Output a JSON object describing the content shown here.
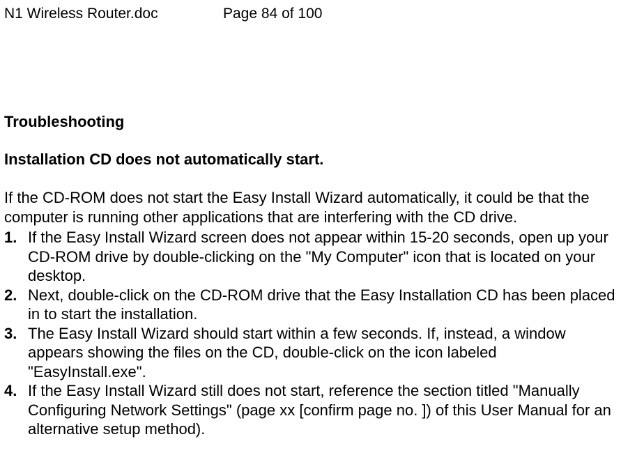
{
  "header": {
    "filename": "N1 Wireless Router.doc",
    "page_indicator": "Page 84 of 100"
  },
  "body": {
    "heading": "Troubleshooting",
    "subheading": "Installation CD does not automatically start.",
    "intro": "If the CD-ROM does not start the Easy Install Wizard automatically, it could be that the computer is running other applications that are interfering with the CD drive.",
    "steps": [
      {
        "num": "1.",
        "text": "If the Easy Install Wizard screen does not appear within 15-20 seconds, open up your CD-ROM drive by double-clicking on the \"My Computer\" icon that is located on your desktop."
      },
      {
        "num": "2.",
        "text": "Next, double-click on the CD-ROM drive that the Easy Installation CD has been placed in to start the installation."
      },
      {
        "num": "3.",
        "text": "The Easy Install Wizard should start within a few seconds. If, instead, a window appears showing the files on the CD, double-click on the icon labeled \"EasyInstall.exe\"."
      },
      {
        "num": "4.",
        "text": "If the Easy Install Wizard still does not start, reference the section titled \"Manually Configuring Network Settings\" (page xx [confirm page no. ]) of this User Manual for an alternative setup method)."
      }
    ]
  }
}
